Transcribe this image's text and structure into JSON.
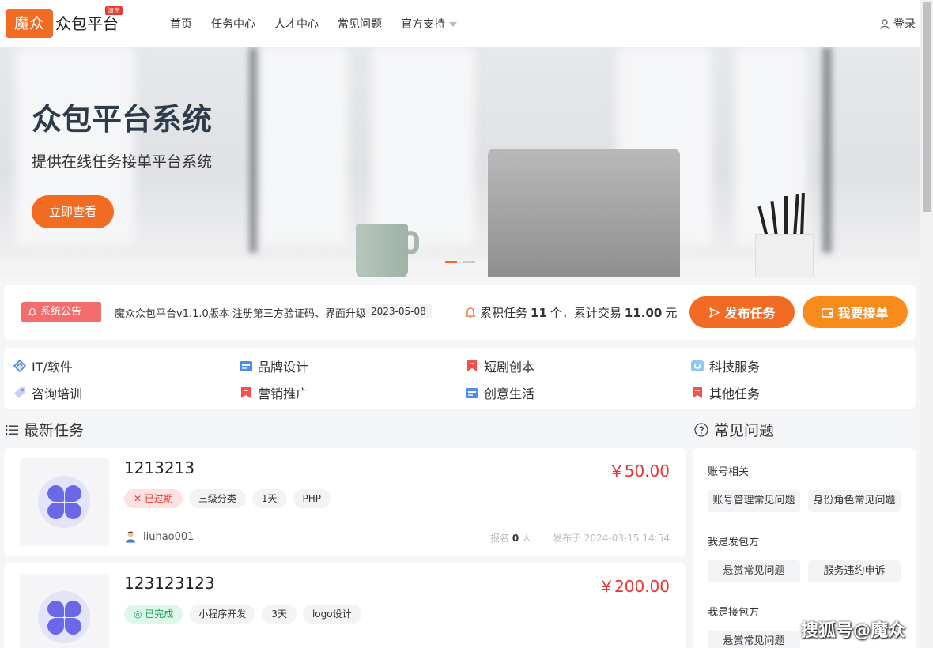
{
  "header": {
    "logo_box": "魔众",
    "logo_text": "众包平台",
    "logo_badge": "演示",
    "nav": [
      "首页",
      "任务中心",
      "人才中心",
      "常见问题",
      "官方支持"
    ],
    "login": "登录"
  },
  "hero": {
    "title": "众包平台系统",
    "subtitle": "提供在线任务接单平台系统",
    "button": "立即查看"
  },
  "notice": {
    "tag": "系统公告",
    "text": "魔众众包平台v1.1.0版本 注册第三方验证码、界面升级",
    "date": "2023-05-08",
    "stats_prefix": "累积任务",
    "task_count": "11",
    "stats_mid": "个，累计交易",
    "trade_amount": "11.00",
    "stats_suffix": "元",
    "publish_button": "发布任务",
    "take_button": "我要接单"
  },
  "categories": [
    {
      "label": "IT/软件",
      "icon": "it-software-icon"
    },
    {
      "label": "品牌设计",
      "icon": "brand-design-icon"
    },
    {
      "label": "短剧创本",
      "icon": "short-drama-icon"
    },
    {
      "label": "科技服务",
      "icon": "tech-service-icon"
    },
    {
      "label": "咨询培训",
      "icon": "consulting-icon"
    },
    {
      "label": "营销推广",
      "icon": "marketing-icon"
    },
    {
      "label": "创意生活",
      "icon": "creative-life-icon"
    },
    {
      "label": "其他任务",
      "icon": "other-tasks-icon"
    }
  ],
  "sections": {
    "latest_tasks": "最新任务",
    "faq": "常见问题"
  },
  "tasks": [
    {
      "title": "1213213",
      "price": "￥50.00",
      "status": "已过期",
      "tags": [
        "三级分类",
        "1天",
        "PHP"
      ],
      "user": "liuhao001",
      "signup_label": "报名",
      "signup_count": "0",
      "signup_unit": "人",
      "published": "发布于 2024-03-15 14:54"
    },
    {
      "title": "123123123",
      "price": "￥200.00",
      "status": "已完成",
      "tags": [
        "小程序开发",
        "3天",
        "logo设计"
      ]
    }
  ],
  "faq": {
    "groups": [
      {
        "title": "账号相关",
        "items": [
          "账号管理常见问题",
          "身份角色常见问题"
        ]
      },
      {
        "title": "我是发包方",
        "items": [
          "悬赏常见问题",
          "服务违约申诉"
        ]
      },
      {
        "title": "我是接包方",
        "items": [
          "悬赏常见问题"
        ]
      }
    ]
  },
  "watermark": "搜狐号@魔众",
  "colors": {
    "accent": "#f26b22",
    "accent_alt": "#f78c1c",
    "price": "#e8352f",
    "notice_tag": "#f36d6d"
  }
}
